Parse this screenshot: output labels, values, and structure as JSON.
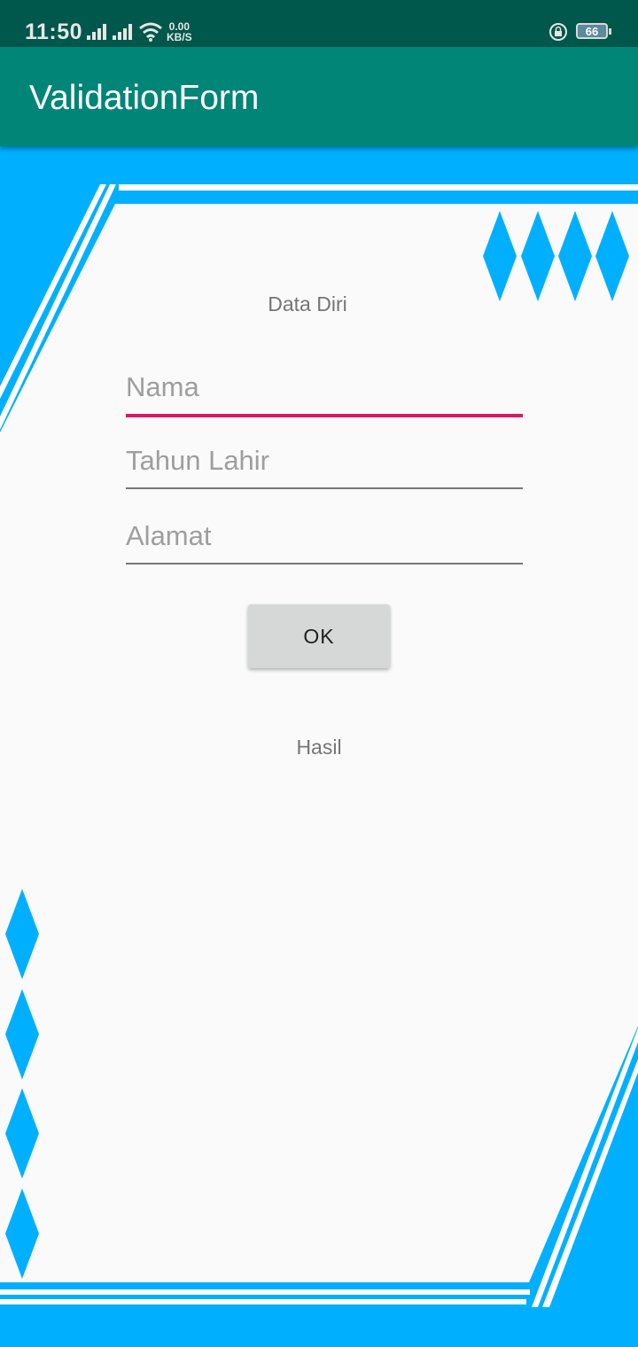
{
  "status_bar": {
    "time": "11:50",
    "net_speed_value": "0.00",
    "net_speed_unit": "KB/S",
    "battery": "66",
    "icons": [
      "signal-icon",
      "signal-icon",
      "wifi-icon",
      "rotation-lock-icon",
      "battery-icon"
    ]
  },
  "app_bar": {
    "title": "ValidationForm"
  },
  "form": {
    "section_title": "Data Diri",
    "name_placeholder": "Nama",
    "name_value": "",
    "birth_year_placeholder": "Tahun Lahir",
    "birth_year_value": "",
    "address_placeholder": "Alamat",
    "address_value": "",
    "ok_label": "OK",
    "result_label": "Hasil"
  },
  "colors": {
    "status_bar": "#00574b",
    "app_bar": "#008577",
    "accent": "#d81b60",
    "decoration_blue": "#00b0ff",
    "background": "#fafafa"
  }
}
